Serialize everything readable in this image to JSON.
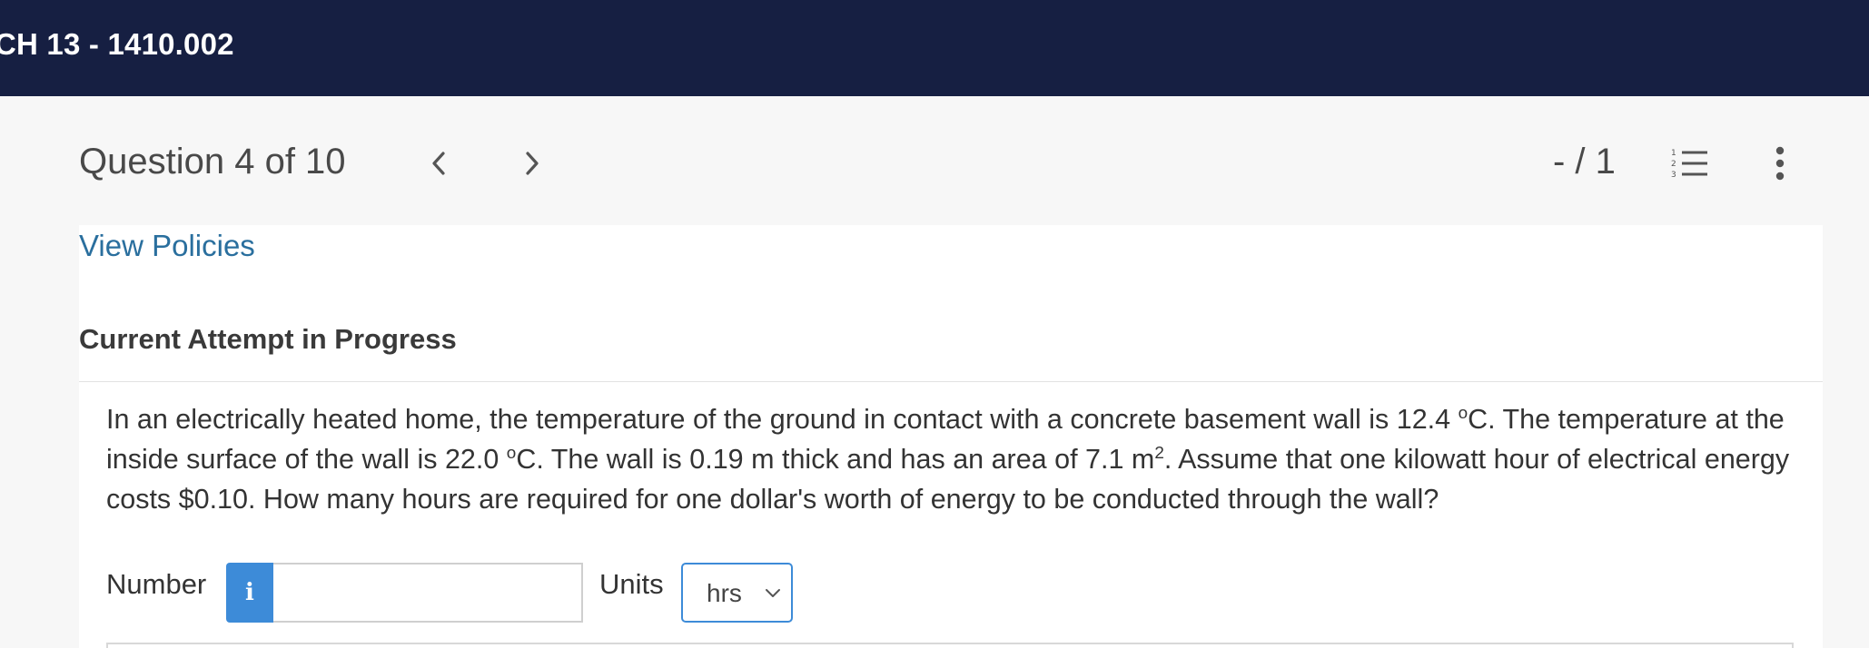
{
  "header": {
    "course_title": "CH 13 - 1410.002"
  },
  "question_nav": {
    "title": "Question 4 of 10",
    "prev_icon": "chevron-left-icon",
    "next_icon": "chevron-right-icon",
    "score": "- / 1",
    "list_icon": "numbered-list-icon",
    "more_icon": "vertical-ellipsis-icon"
  },
  "policies": {
    "link_label": "View Policies"
  },
  "attempt": {
    "heading": "Current Attempt in Progress"
  },
  "question": {
    "text_part1": "In an electrically heated home, the temperature of the ground in contact with a concrete basement wall is 12.4 ",
    "deg1": "o",
    "text_part2": "C. The temperature at the inside surface of the wall is 22.0 ",
    "deg2": "o",
    "text_part3": "C. The wall is 0.19 m thick and has an area of 7.1 m",
    "exp": "2",
    "text_part4": ". Assume that one kilowatt hour of electrical energy costs $0.10. How many hours are required for one dollar's worth of energy to be conducted through the wall?"
  },
  "answer": {
    "number_label": "Number",
    "info_icon_glyph": "i",
    "number_value": "",
    "units_label": "Units",
    "units_selected": "hrs"
  },
  "colors": {
    "topbar": "#161f42",
    "link": "#2a6f9e",
    "accent": "#3d8bd8"
  }
}
